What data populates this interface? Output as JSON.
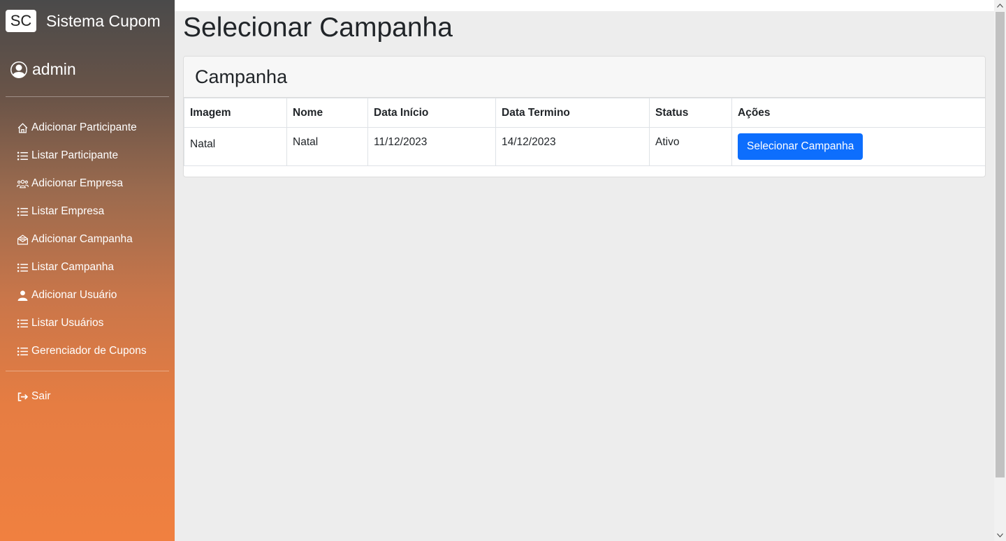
{
  "brand": {
    "badge": "SC",
    "name": "Sistema Cupom"
  },
  "user": {
    "name": "admin",
    "icon": "user-circle-icon"
  },
  "sidebar": {
    "items": [
      {
        "label": "Adicionar Participante",
        "icon": "home-icon"
      },
      {
        "label": "Listar Participante",
        "icon": "list-icon"
      },
      {
        "label": "Adicionar Empresa",
        "icon": "people-icon"
      },
      {
        "label": "Listar Empresa",
        "icon": "list-icon"
      },
      {
        "label": "Adicionar Campanha",
        "icon": "envelope-open-icon"
      },
      {
        "label": "Listar Campanha",
        "icon": "list-icon"
      },
      {
        "label": "Adicionar Usuário",
        "icon": "person-icon"
      },
      {
        "label": "Listar Usuários",
        "icon": "list-icon"
      },
      {
        "label": "Gerenciador de Cupons",
        "icon": "list-icon"
      }
    ],
    "logout": {
      "label": "Sair",
      "icon": "logout-icon"
    }
  },
  "main": {
    "title": "Selecionar Campanha",
    "card": {
      "title": "Campanha",
      "table": {
        "headers": [
          "Imagem",
          "Nome",
          "Data Início",
          "Data Termino",
          "Status",
          "Ações"
        ],
        "rows": [
          {
            "imagem": "Natal",
            "nome": "Natal",
            "data_inicio": "11/12/2023",
            "data_termino": "14/12/2023",
            "status": "Ativo",
            "action_label": "Selecionar Campanha"
          }
        ]
      }
    }
  },
  "colors": {
    "primary": "#0d6efd",
    "sidebar_top": "#4a4a4a",
    "sidebar_bottom": "#f08040",
    "background": "#ededed"
  }
}
